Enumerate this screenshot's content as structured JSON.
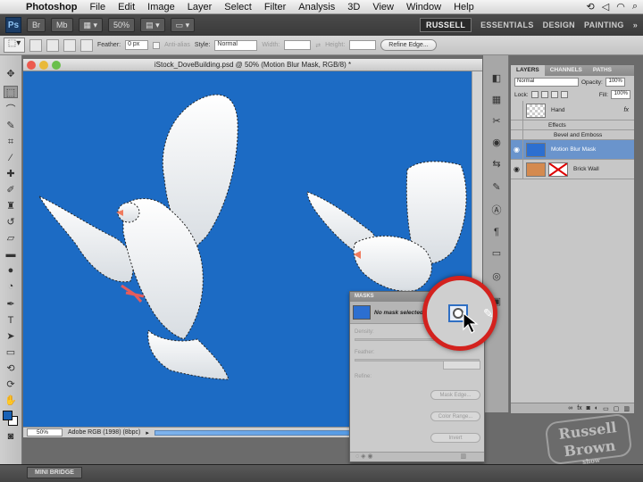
{
  "menubar": {
    "app": "Photoshop",
    "items": [
      "File",
      "Edit",
      "Image",
      "Layer",
      "Select",
      "Filter",
      "Analysis",
      "3D",
      "View",
      "Window",
      "Help"
    ]
  },
  "appbar": {
    "logo": "Ps",
    "zoom": "50%",
    "workspaces": [
      "RUSSELL",
      "ESSENTIALS",
      "DESIGN",
      "PAINTING"
    ],
    "overflow": "»"
  },
  "options": {
    "feather_label": "Feather:",
    "feather_value": "0 px",
    "antialias_label": "Anti-alias",
    "style_label": "Style:",
    "style_value": "Normal",
    "width_label": "Width:",
    "height_label": "Height:",
    "refine_edge": "Refine Edge..."
  },
  "document": {
    "title": "iStock_DoveBuilding.psd @ 50% (Motion Blur Mask, RGB/8) *",
    "zoom": "50%",
    "profile": "Adobe RGB (1998) (8bpc)"
  },
  "layers_panel": {
    "tabs": [
      "LAYERS",
      "CHANNELS",
      "PATHS"
    ],
    "blend_mode": "Normal",
    "opacity_label": "Opacity:",
    "opacity_value": "100%",
    "lock_label": "Lock:",
    "fill_label": "Fill:",
    "fill_value": "100%",
    "layers": [
      {
        "name": "Hand",
        "fx": "fx"
      },
      {
        "name": "Effects"
      },
      {
        "name": "Bevel and Emboss"
      },
      {
        "name": "Motion Blur Mask"
      },
      {
        "name": "Brick Wall"
      }
    ]
  },
  "masks_panel": {
    "tab": "MASKS",
    "status": "No mask selected",
    "density_label": "Density:",
    "feather_label": "Feather:",
    "refine_label": "Refine:",
    "buttons": [
      "Mask Edge...",
      "Color Range...",
      "Invert"
    ]
  },
  "minibridge": {
    "label": "MINI BRIDGE"
  },
  "watermark": {
    "line1": "Russell",
    "line2": "Brown",
    "line3": "show"
  },
  "colors": {
    "sky": "#1c6bc4",
    "callout_ring": "#d3221e",
    "selected_layer": "#6a94cc"
  }
}
